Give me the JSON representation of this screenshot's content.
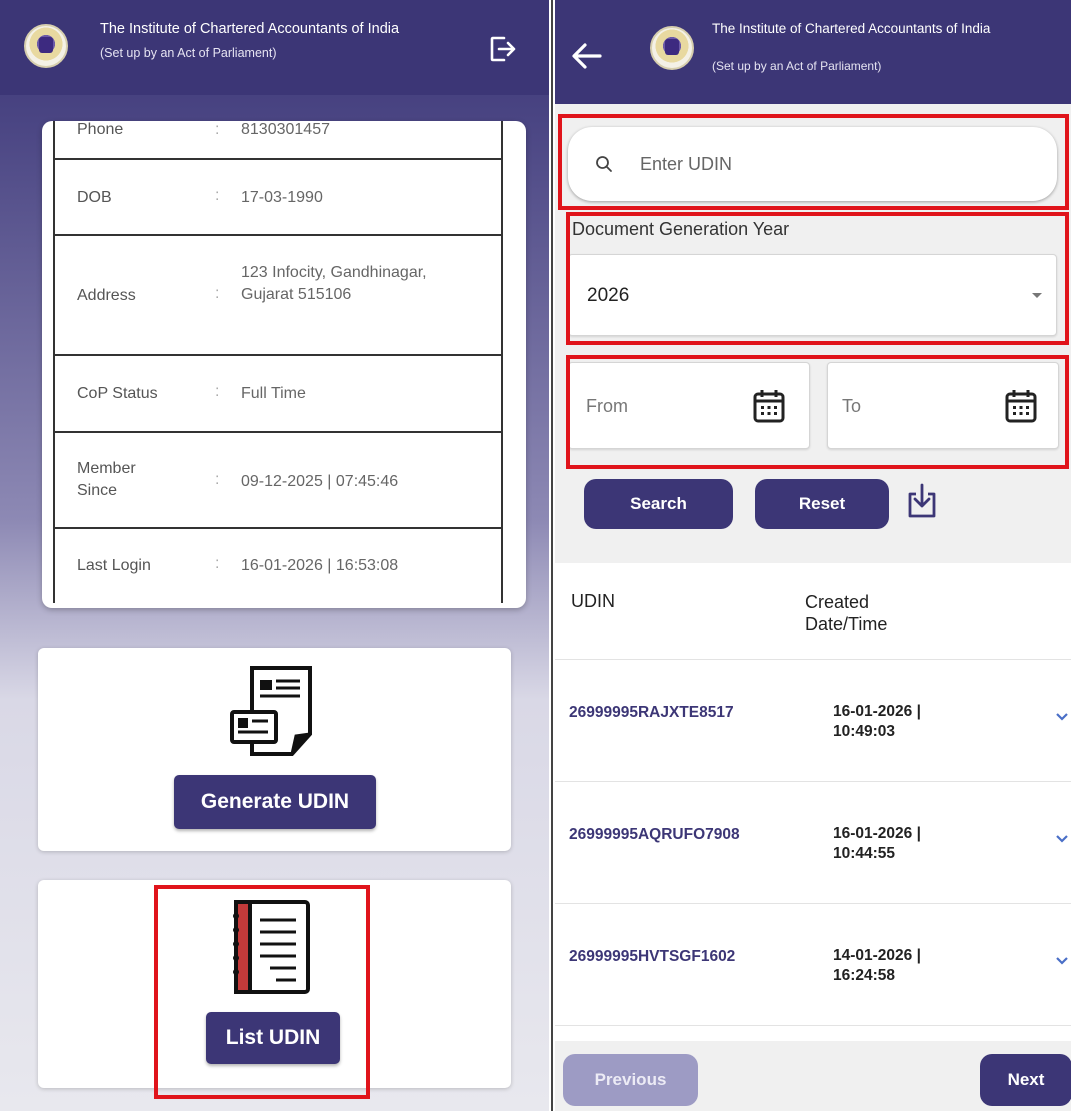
{
  "left": {
    "header": {
      "title": "The Institute of Chartered Accountants of India",
      "subtitle": "(Set up by an Act of Parliament)"
    },
    "profile": [
      {
        "label": "Phone",
        "value": "8130301457"
      },
      {
        "label": "DOB",
        "value": "17-03-1990"
      },
      {
        "label": "Address",
        "value": "123 Infocity, Gandhinagar, Gujarat 515106"
      },
      {
        "label": "CoP Status",
        "value": "Full Time"
      },
      {
        "label": "Member Since",
        "value": "09-12-2025 | 07:45:46"
      },
      {
        "label": "Last Login",
        "value": "16-01-2026 | 16:53:08"
      }
    ],
    "separator": ":",
    "generate_label": "Generate UDIN",
    "list_label": "List UDIN"
  },
  "right": {
    "header": {
      "title": "The Institute of Chartered Accountants of India",
      "subtitle": "(Set up by an Act of Parliament)"
    },
    "search_placeholder": "Enter UDIN",
    "year_label": "Document Generation Year",
    "year_value": "2026",
    "from_label": "From",
    "to_label": "To",
    "search_button": "Search",
    "reset_button": "Reset",
    "columns": [
      "UDIN",
      "Created Date/Time"
    ],
    "rows": [
      {
        "udin": "26999995RAJXTE8517",
        "date": "16-01-2026 |",
        "time": "10:49:03"
      },
      {
        "udin": "26999995AQRUFO7908",
        "date": "16-01-2026 |",
        "time": "10:44:55"
      },
      {
        "udin": "26999995HVTSGF1602",
        "date": "14-01-2026 |",
        "time": "16:24:58"
      }
    ],
    "previous_button": "Previous",
    "next_button": "Next"
  },
  "colors": {
    "header": "#3c3676",
    "button": "#3c3676",
    "highlight": "#e0141b",
    "link": "#3c3676",
    "chevron": "#4a6fc7"
  }
}
